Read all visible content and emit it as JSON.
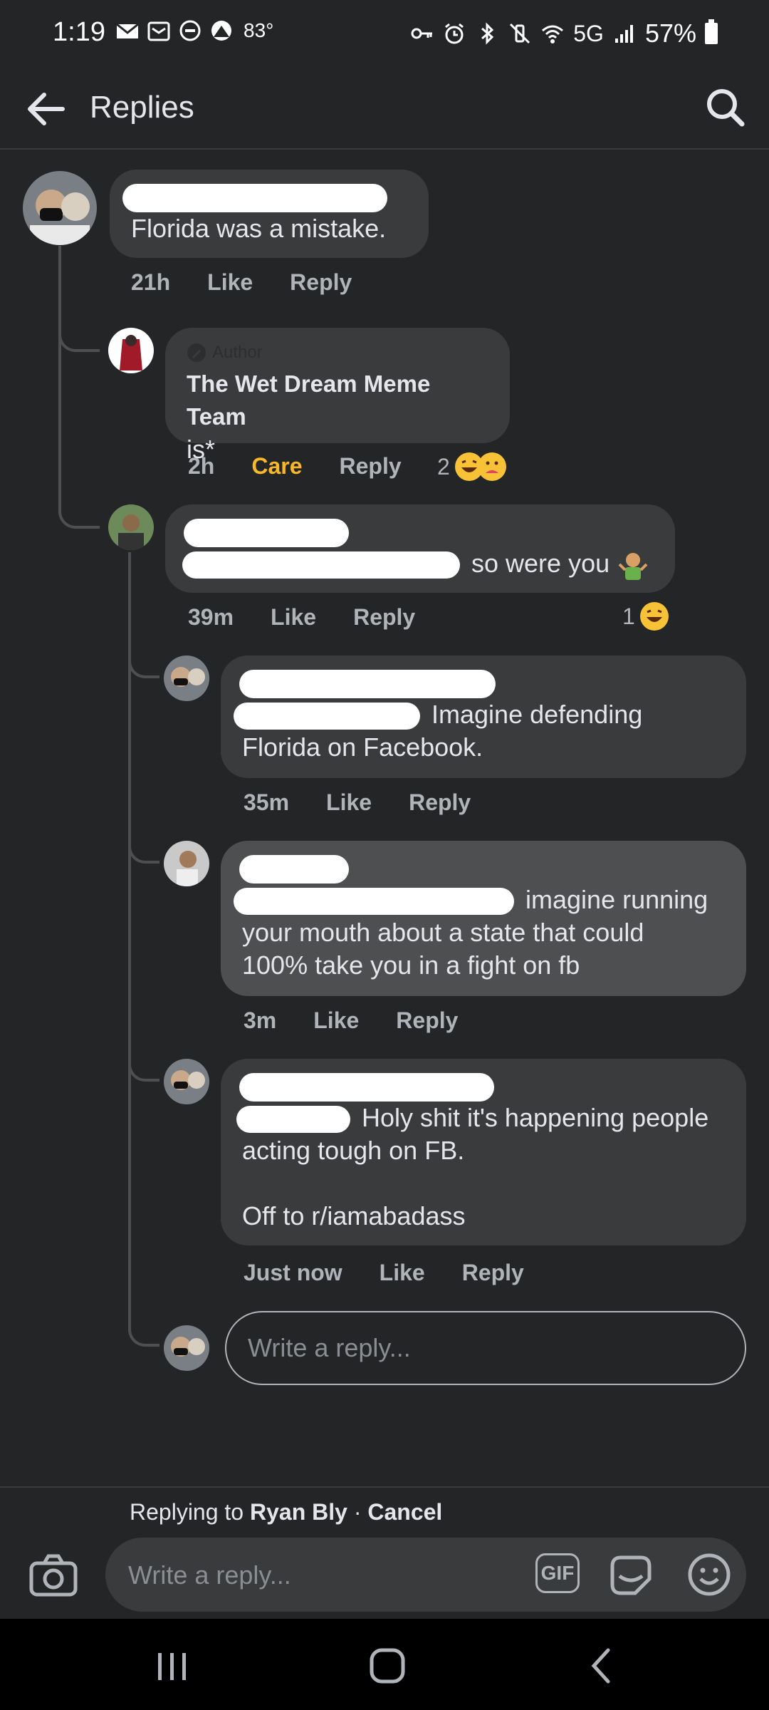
{
  "status_bar": {
    "time": "1:19",
    "temperature": "83°",
    "network": "5G",
    "battery": "57%"
  },
  "header": {
    "title": "Replies"
  },
  "comments": [
    {
      "text": "Florida was a mistake.",
      "time": "21h",
      "like": "Like",
      "reply": "Reply"
    },
    {
      "author_tag": "Author",
      "author": "The Wet Dream Meme Team",
      "text": "is*",
      "time": "2h",
      "reaction_label": "Care",
      "reply": "Reply",
      "reaction_count": "2"
    },
    {
      "text": "so were you",
      "time": "39m",
      "like": "Like",
      "reply": "Reply",
      "reaction_count": "1"
    },
    {
      "text_line1": "Imagine defending",
      "text_line2": "Florida on Facebook.",
      "time": "35m",
      "like": "Like",
      "reply": "Reply"
    },
    {
      "text_line1": "imagine running",
      "text_line2": "your mouth about a state that could",
      "text_line3": "100% take you in a fight on fb",
      "time": "3m",
      "like": "Like",
      "reply": "Reply"
    },
    {
      "text_line1": "Holy shit it's happening people",
      "text_line2": "acting tough on FB.",
      "text_line3": "Off to r/iamabadass",
      "time": "Just now",
      "like": "Like",
      "reply": "Reply"
    }
  ],
  "inline_reply": {
    "placeholder": "Write a reply..."
  },
  "composer": {
    "replying_prefix": "Replying to",
    "replying_name": "Ryan Bly",
    "separator": "·",
    "cancel": "Cancel",
    "placeholder": "Write a reply...",
    "gif_label": "GIF"
  },
  "colors": {
    "background": "#242526",
    "bubble": "#3a3b3c",
    "care": "#f7b928",
    "secondary_text": "#b0b3b8"
  }
}
